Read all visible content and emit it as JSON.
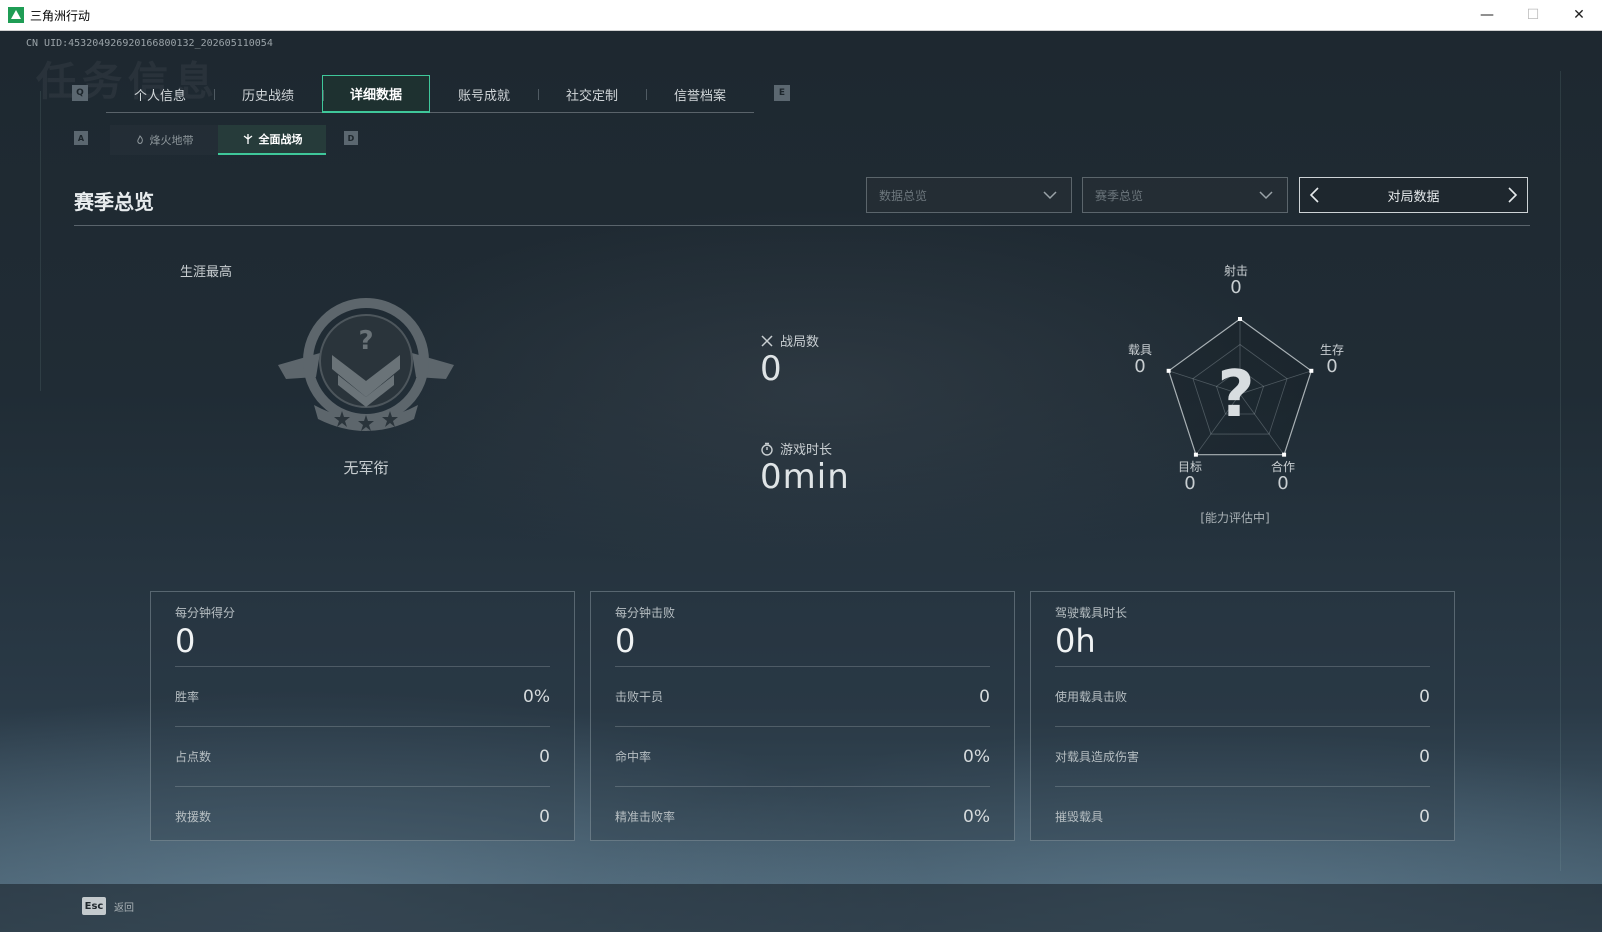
{
  "window": {
    "title": "三角洲行动",
    "minimize": "—",
    "maximize": "☐",
    "close": "✕"
  },
  "uid": "CN UID:453204926920166800132_202605110054",
  "ghost_title": "任务信息",
  "tabs": {
    "prev_key": "Q",
    "next_key": "E",
    "items": [
      {
        "label": "个人信息",
        "active": false
      },
      {
        "label": "历史战绩",
        "active": false
      },
      {
        "label": "详细数据",
        "active": true
      },
      {
        "label": "账号成就",
        "active": false
      },
      {
        "label": "社交定制",
        "active": false
      },
      {
        "label": "信誉档案",
        "active": false
      }
    ]
  },
  "subtabs": {
    "prev_key": "A",
    "next_key": "D",
    "items": [
      {
        "label": "烽火地带",
        "icon": "flame-icon",
        "active": false
      },
      {
        "label": "全面战场",
        "icon": "battlefield-icon",
        "active": true
      }
    ]
  },
  "header": {
    "title": "赛季总览",
    "dropdown_data": "数据总览",
    "dropdown_season": "赛季总览",
    "pager_label": "对局数据"
  },
  "rank": {
    "caption": "生涯最高",
    "name": "无军衔"
  },
  "center": {
    "matches_label": "战局数",
    "matches_value": "0",
    "playtime_label": "游戏时长",
    "playtime_value": "0min"
  },
  "radar": {
    "shooting_label": "射击",
    "shooting_value": "0",
    "survival_label": "生存",
    "survival_value": "0",
    "teamwork_label": "合作",
    "teamwork_value": "0",
    "objective_label": "目标",
    "objective_value": "0",
    "vehicle_label": "载具",
    "vehicle_value": "0",
    "center_glyph": "?",
    "status": "[能力评估中]",
    "values": [
      0,
      0,
      0,
      0,
      0
    ]
  },
  "cards": [
    {
      "title": "每分钟得分",
      "value": "0",
      "rows": [
        {
          "label": "胜率",
          "value": "0%"
        },
        {
          "label": "占点数",
          "value": "0"
        },
        {
          "label": "救援数",
          "value": "0"
        }
      ]
    },
    {
      "title": "每分钟击败",
      "value": "0",
      "rows": [
        {
          "label": "击败干员",
          "value": "0"
        },
        {
          "label": "命中率",
          "value": "0%"
        },
        {
          "label": "精准击败率",
          "value": "0%"
        }
      ]
    },
    {
      "title": "驾驶载具时长",
      "value": "0h",
      "rows": [
        {
          "label": "使用载具击败",
          "value": "0"
        },
        {
          "label": "对载具造成伤害",
          "value": "0"
        },
        {
          "label": "摧毁载具",
          "value": "0"
        }
      ]
    }
  ],
  "footer": {
    "esc_key": "Esc",
    "back_label": "返回"
  },
  "colors": {
    "accent": "#3fc79a",
    "background": "#1e2a33",
    "text": "#d8dde0"
  }
}
